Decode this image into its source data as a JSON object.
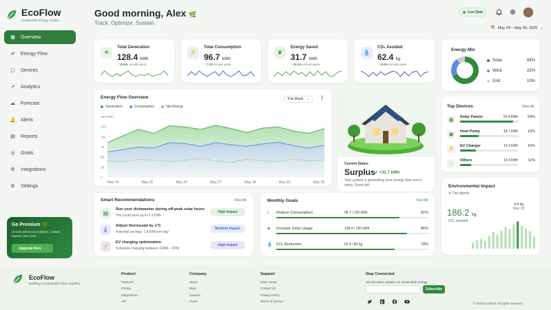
{
  "brand": {
    "name": "EcoFlow",
    "tagline": "Sustainable Energy Tracker"
  },
  "nav": [
    {
      "label": "Overview",
      "icon": "grid-icon",
      "active": true
    },
    {
      "label": "Energy Flow",
      "icon": "flow-icon"
    },
    {
      "label": "Devices",
      "icon": "devices-icon"
    },
    {
      "label": "Analytics",
      "icon": "chart-icon"
    },
    {
      "label": "Forecast",
      "icon": "forecast-icon"
    },
    {
      "label": "Alerts",
      "icon": "bell-icon"
    },
    {
      "label": "Reports",
      "icon": "report-icon"
    },
    {
      "label": "Goals",
      "icon": "target-icon"
    },
    {
      "label": "Integrations",
      "icon": "integration-icon"
    },
    {
      "label": "Settings",
      "icon": "gear-icon"
    }
  ],
  "premium": {
    "title": "Go Premium",
    "desc": "Unlock advanced analytics, custom reports, and more.",
    "button": "Upgrade Now"
  },
  "header": {
    "greeting": "Good morning, Alex",
    "tagline": "Track. Optimize. Sustain.",
    "live": "Live Data",
    "date_range": "May 24 – May 30, 2025"
  },
  "kpis": [
    {
      "label": "Total Generation",
      "value": "128.4",
      "unit": "kWh",
      "change": "↑ 18.6%",
      "note": "vs last week",
      "icon": "sun-icon",
      "color": "#e8f5e3"
    },
    {
      "label": "Total Consumption",
      "value": "96.7",
      "unit": "kWh",
      "change": "↓ 7.3%",
      "note": "vs last week",
      "icon": "bolt-icon",
      "color": "#e6eefb"
    },
    {
      "label": "Energy Saved",
      "value": "31.7",
      "unit": "kWh",
      "change": "↑ 23.4%",
      "note": "vs last week",
      "icon": "leaf-icon",
      "color": "#e6f4e6"
    },
    {
      "label": "CO₂ Avoided",
      "value": "62.4",
      "unit": "kg",
      "change": "↑ 15.8%",
      "note": "vs last week",
      "icon": "drop-icon",
      "color": "#efe8fb"
    }
  ],
  "energy_mix": {
    "title": "Energy Mix",
    "items": [
      {
        "name": "Solar",
        "value": "68%",
        "color": "#2f8a3e"
      },
      {
        "name": "Wind",
        "value": "22%",
        "color": "#5b8de6"
      },
      {
        "name": "Grid",
        "value": "10%",
        "color": "#c9d2cb"
      }
    ]
  },
  "flow": {
    "title": "Energy Flow Overview",
    "period": "This Week"
  },
  "chart_data": {
    "type": "area",
    "x": [
      "May 24",
      "May 25",
      "May 26",
      "May 27",
      "May 28",
      "May 29",
      "May 30"
    ],
    "ylim": [
      0,
      150
    ],
    "yticks": [
      "150 kWh",
      "125",
      "100",
      "75",
      "50",
      "25",
      "0"
    ],
    "series": [
      {
        "name": "Generation",
        "values": [
          85,
          102,
          118,
          108,
          127,
          124,
          118,
          128,
          120,
          110,
          121,
          124,
          114,
          108,
          120
        ],
        "color": "#4caf50"
      },
      {
        "name": "Consumption",
        "values": [
          62,
          68,
          74,
          72,
          85,
          83,
          76,
          85,
          80,
          76,
          82,
          86,
          78,
          72,
          79
        ],
        "color": "#5b8de6"
      },
      {
        "name": "Net Energy",
        "values": [
          40,
          38,
          44,
          42,
          38,
          42,
          46,
          40,
          36,
          44,
          40,
          38,
          44,
          40,
          42
        ],
        "color": "#7fbf86"
      }
    ]
  },
  "status": {
    "label": "Current Status",
    "value": "Surplus",
    "delta": "+31.7 kWh",
    "desc": "Your system is generating more energy than you're using. Great job!"
  },
  "devices": {
    "title": "Top Devices",
    "view_all": "View All",
    "items": [
      {
        "name": "Solar Panels",
        "value": "52.4 kWh",
        "pct": "54%",
        "fill": 0.54,
        "icon": "solar-panel-icon"
      },
      {
        "name": "Heat Pump",
        "value": "18.7 kWh",
        "pct": "19%",
        "fill": 0.19,
        "icon": "heat-pump-icon"
      },
      {
        "name": "EV Charger",
        "value": "15.3 kWh",
        "pct": "16%",
        "fill": 0.16,
        "icon": "ev-charger-icon"
      },
      {
        "name": "Others",
        "value": "10.3 kWh",
        "pct": "11%",
        "fill": 0.11,
        "icon": "others-icon"
      }
    ]
  },
  "recommendations": {
    "title": "Smart Recommendations",
    "view_all": "View All",
    "items": [
      {
        "title": "Run your dishwasher during off-peak solar hours",
        "sub": "You could save up to 2.3 kWh",
        "badge": "High Impact",
        "icon": "dishwasher-icon",
        "bg": "#e3f3e3",
        "fg": "#2f7d3c"
      },
      {
        "title": "Adjust thermostat by 1°C",
        "sub": "Potential savings: 1.8 kWh per day",
        "badge": "Medium Impact",
        "icon": "thermostat-icon",
        "bg": "#e4ecfa",
        "fg": "#3f6fc4"
      },
      {
        "title": "EV charging optimization",
        "sub": "Schedule charging between 10AM – 2PM",
        "badge": "High Impact",
        "icon": "ev-icon",
        "bg": "#ece4fa",
        "fg": "#6b4fc4"
      }
    ]
  },
  "goals": {
    "title": "Monthly Goals",
    "view_all": "View All",
    "items": [
      {
        "name": "Reduce Consumption",
        "value": "96.7 / 120 kWh",
        "pct": "81%",
        "fill": 0.81,
        "icon": "home-icon"
      },
      {
        "name": "Increase Solar Usage",
        "value": "128.4 / 150 kWh",
        "pct": "86%",
        "fill": 0.86,
        "icon": "solar-icon"
      },
      {
        "name": "CO₂ Reduction",
        "value": "62.4 / 80 kg",
        "pct": "78%",
        "fill": 0.78,
        "icon": "co2-icon"
      }
    ]
  },
  "impact": {
    "title": "Environmental Impact",
    "period": "This Month",
    "value": "186.2",
    "unit": "kg",
    "sub": "CO₂ avoided",
    "bar_label": "6.4 kg",
    "bar_date": "May 28",
    "bars": [
      0.2,
      0.28,
      0.33,
      0.25,
      0.42,
      0.55,
      0.46,
      0.6,
      0.72,
      0.66,
      0.8,
      0.9,
      0.75,
      0.68,
      0.58,
      0.4
    ]
  },
  "footer": {
    "brand": "EcoFlow",
    "tagline": "Building a sustainable future together.",
    "product": {
      "h": "Product",
      "links": [
        "Features",
        "Pricing",
        "Integrations",
        "API"
      ]
    },
    "company": {
      "h": "Company",
      "links": [
        "About",
        "Blog",
        "Careers",
        "Press"
      ]
    },
    "support": {
      "h": "Support",
      "links": [
        "Help Center",
        "Contact Us",
        "Privacy Policy",
        "Terms of Service"
      ]
    },
    "connected": {
      "h": "Stay Connected",
      "desc": "Get the latest updates on sustainable energy.",
      "subscribe": "Subscribe"
    },
    "copyright": "© 2025 EcoFlow. All rights reserved."
  }
}
